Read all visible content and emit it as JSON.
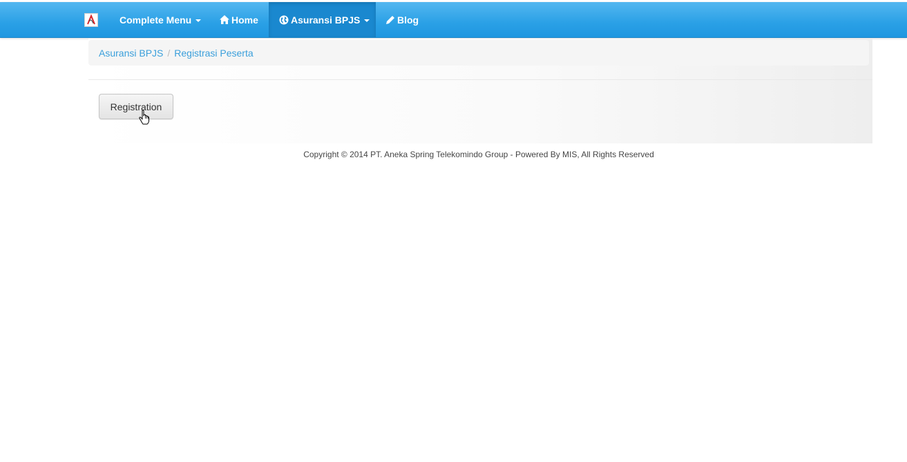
{
  "navbar": {
    "brand_icon": "app-logo-icon",
    "items": [
      {
        "label": "Complete Menu",
        "has_caret": true
      },
      {
        "label": "Home",
        "icon": "home-icon"
      },
      {
        "label": "Asuransi BPJS",
        "icon": "globe-icon",
        "has_caret": true,
        "active": true
      },
      {
        "label": "Blog",
        "icon": "pencil-icon"
      }
    ]
  },
  "breadcrumb": {
    "items": [
      "Asuransi BPJS",
      "Registrasi Peserta"
    ],
    "separator": "/"
  },
  "main": {
    "registration_button": "Registration"
  },
  "footer": {
    "copyright": "Copyright © 2014 PT. Aneka Spring Telekomindo Group - Powered By MIS, All Rights Reserved"
  },
  "colors": {
    "navbar": "#2aa0e6",
    "navbar_active": "#1a88cf",
    "link": "#3a9fdb",
    "breadcrumb_bg": "#f5f5f5"
  }
}
